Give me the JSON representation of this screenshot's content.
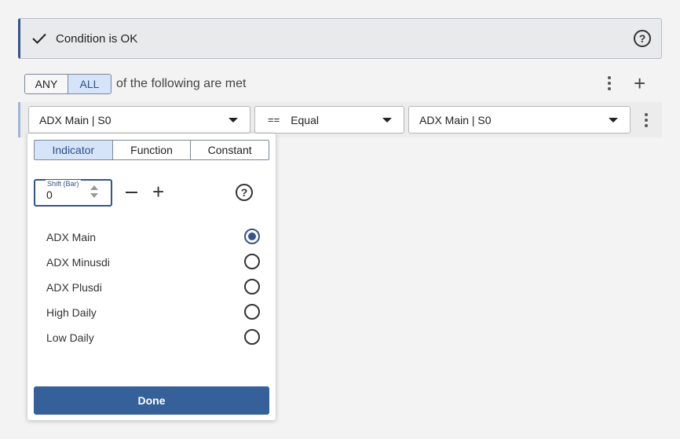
{
  "status": {
    "text": "Condition is OK",
    "icon": "check-icon",
    "help_icon": "question-circle-icon",
    "help_glyph": "?"
  },
  "match": {
    "options": [
      "ANY",
      "ALL"
    ],
    "selected": "ALL",
    "text": "of the following are met",
    "add_glyph": "+"
  },
  "condition": {
    "left": "ADX Main | S0",
    "operator_symbol": "==",
    "operator": "Equal",
    "right": "ADX Main | S0"
  },
  "picker": {
    "tabs": [
      "Indicator",
      "Function",
      "Constant"
    ],
    "active_tab": "Indicator",
    "shift": {
      "label": "Shift (Bar)",
      "value": "0"
    },
    "plus_glyph": "+",
    "help_glyph": "?",
    "options": [
      {
        "label": "ADX Main",
        "checked": true
      },
      {
        "label": "ADX Minusdi",
        "checked": false
      },
      {
        "label": "ADX Plusdi",
        "checked": false
      },
      {
        "label": "High Daily",
        "checked": false
      },
      {
        "label": "Low Daily",
        "checked": false
      }
    ],
    "done_label": "Done"
  },
  "colors": {
    "accent": "#35558a",
    "selected_bg": "#d6e4fa",
    "done_bg": "#35609a"
  }
}
